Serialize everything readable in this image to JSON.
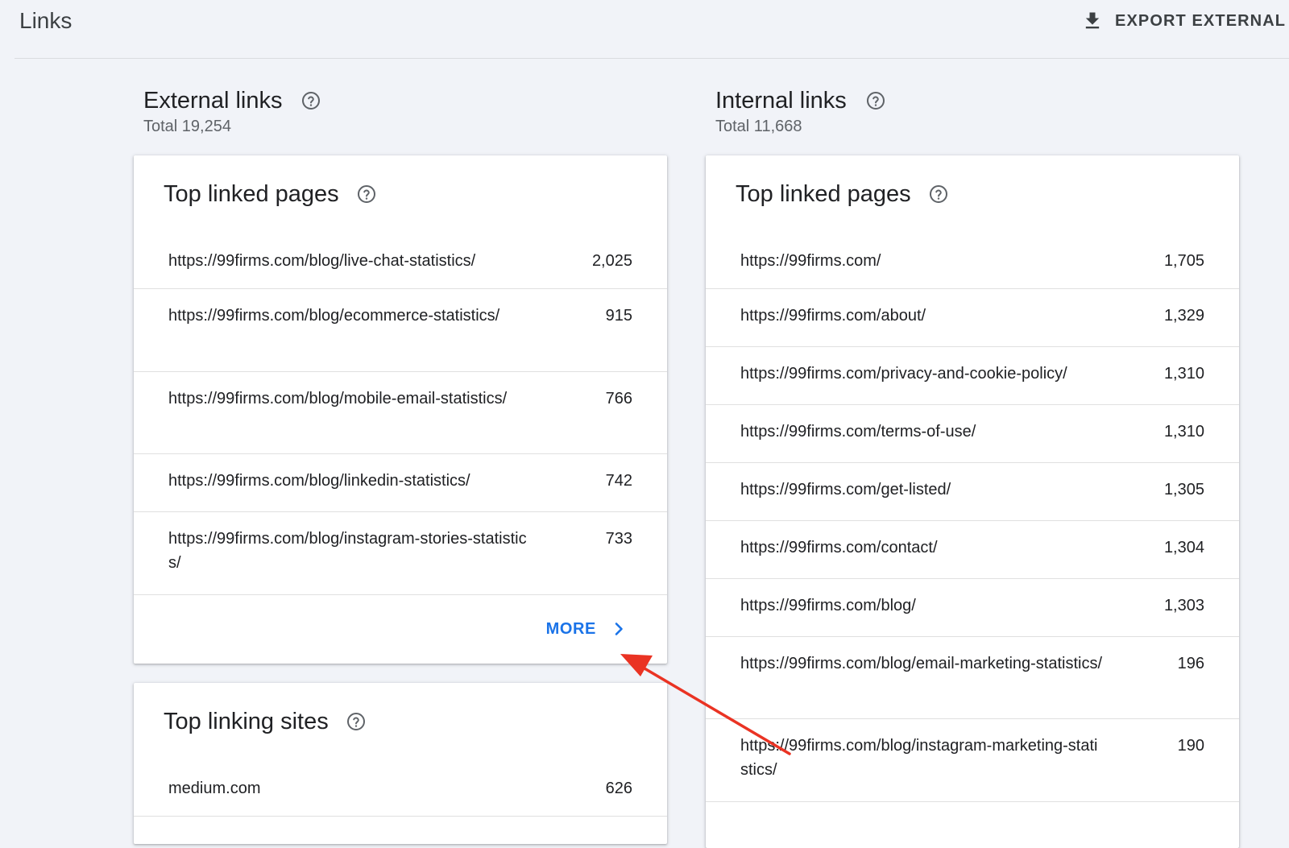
{
  "header": {
    "title": "Links",
    "export_label": "EXPORT EXTERNAL LINKS"
  },
  "external": {
    "title": "External links",
    "total": "Total 19,254",
    "top_linked_pages": {
      "title": "Top linked pages",
      "rows": [
        {
          "url": "https://99firms.com/blog/live-chat-statistics/",
          "count": "2,025"
        },
        {
          "url": "https://99firms.com/blog/ecommerce-statistics/",
          "count": "915"
        },
        {
          "url": "https://99firms.com/blog/mobile-email-statistics/",
          "count": "766"
        },
        {
          "url": "https://99firms.com/blog/linkedin-statistics/",
          "count": "742"
        },
        {
          "url": "https://99firms.com/blog/instagram-stories-statistics/",
          "count": "733"
        }
      ],
      "more_label": "MORE"
    },
    "top_linking_sites": {
      "title": "Top linking sites",
      "rows": [
        {
          "site": "medium.com",
          "count": "626"
        }
      ]
    }
  },
  "internal": {
    "title": "Internal links",
    "total": "Total 11,668",
    "top_linked_pages": {
      "title": "Top linked pages",
      "rows": [
        {
          "url": "https://99firms.com/",
          "count": "1,705"
        },
        {
          "url": "https://99firms.com/about/",
          "count": "1,329"
        },
        {
          "url": "https://99firms.com/privacy-and-cookie-policy/",
          "count": "1,310"
        },
        {
          "url": "https://99firms.com/terms-of-use/",
          "count": "1,310"
        },
        {
          "url": "https://99firms.com/get-listed/",
          "count": "1,305"
        },
        {
          "url": "https://99firms.com/contact/",
          "count": "1,304"
        },
        {
          "url": "https://99firms.com/blog/",
          "count": "1,303"
        },
        {
          "url": "https://99firms.com/blog/email-marketing-statistics/",
          "count": "196"
        },
        {
          "url": "https://99firms.com/blog/instagram-marketing-statistics/",
          "count": "190"
        }
      ]
    }
  },
  "icons": {
    "help": "help-circle-icon",
    "download": "download-icon",
    "chevron": "chevron-right-icon"
  },
  "colors": {
    "accent": "#1a73e8",
    "annotation_arrow": "#ea3323",
    "background": "#f1f3f8"
  }
}
